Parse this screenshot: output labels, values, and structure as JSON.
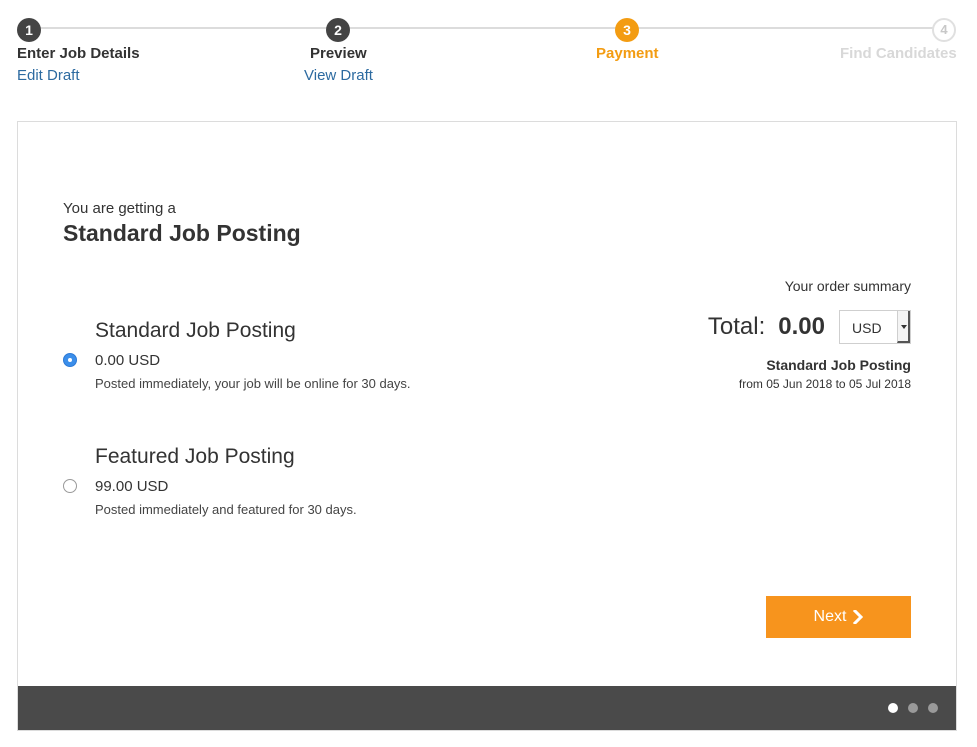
{
  "stepper": {
    "steps": [
      {
        "number": "1",
        "title": "Enter Job Details",
        "link": "Edit Draft",
        "state": "done"
      },
      {
        "number": "2",
        "title": "Preview",
        "link": "View Draft",
        "state": "done"
      },
      {
        "number": "3",
        "title": "Payment",
        "state": "active"
      },
      {
        "number": "4",
        "title": "Find Candidates",
        "state": "todo"
      }
    ]
  },
  "plan": {
    "intro": "You are getting a",
    "heading": "Standard Job Posting"
  },
  "options": [
    {
      "title": "Standard Job Posting",
      "price": "0.00 USD",
      "description": "Posted immediately, your job will be online for 30 days.",
      "selected": true
    },
    {
      "title": "Featured Job Posting",
      "price": "99.00 USD",
      "description": "Posted immediately and featured for 30 days.",
      "selected": false
    }
  ],
  "summary": {
    "label": "Your order summary",
    "total_label": "Total:",
    "total_value": "0.00",
    "currency": "USD",
    "plan_name": "Standard Job Posting",
    "dates": "from 05 Jun 2018 to 05 Jul 2018"
  },
  "actions": {
    "next_label": "Next"
  },
  "pager": {
    "current": 1,
    "total": 3
  },
  "colors": {
    "accent": "#f39c12",
    "button": "#f7941d",
    "link": "#2c6aa0",
    "radio_selected": "#3b8eea",
    "footer": "#4a4a4a"
  }
}
